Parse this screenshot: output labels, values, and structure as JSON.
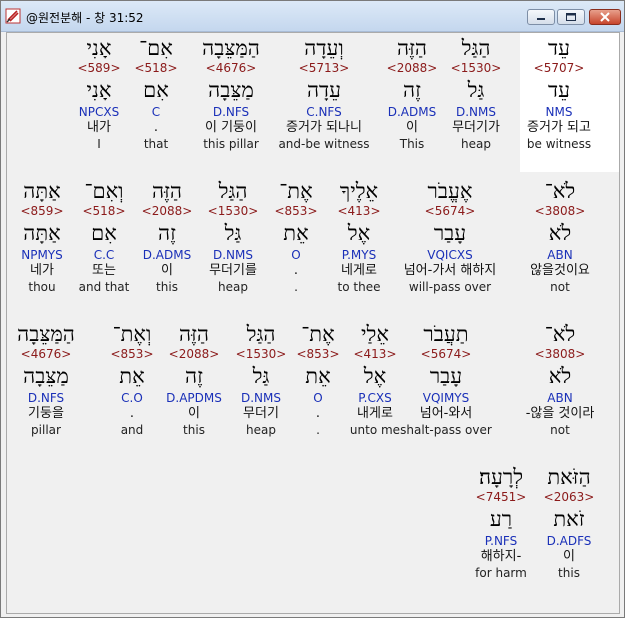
{
  "window": {
    "title": "@원전분해 - 창 31:52",
    "buttons": {
      "minimize": "minimize-icon",
      "maximize": "maximize-icon",
      "close": "close-icon"
    }
  },
  "colors": {
    "strong": "#8b1a1a",
    "morph": "#1a30b8",
    "highlight_bg": "#ffffff"
  },
  "rows": [
    {
      "words": [
        {
          "heb": "עֵד",
          "strong": "<5707>",
          "root": "עֵד",
          "morph": "NMS",
          "kor": "증거가 되고",
          "eng": "be witness"
        },
        {
          "heb": "הַגַּל",
          "strong": "<1530>",
          "root": "גַּל",
          "morph": "D.NMS",
          "kor": "무더기가",
          "eng": "heap"
        },
        {
          "heb": "הַזֶּה",
          "strong": "<2088>",
          "root": "זֶה",
          "morph": "D.ADMS",
          "kor": "이",
          "eng": "This"
        },
        {
          "heb": "וְעֵדָה",
          "strong": "<5713>",
          "root": "עֵדָה",
          "morph": "C.NFS",
          "kor": "증거가 되나니",
          "eng": "and-be witness"
        },
        {
          "heb": "הַמַּצֵּבָה",
          "strong": "<4676>",
          "root": "מַצֵּבָה",
          "morph": "D.NFS",
          "kor": "이 기둥이",
          "eng": "this pillar"
        },
        {
          "heb": "אִם־",
          "strong": "<518>",
          "root": "אִם",
          "morph": "C",
          "kor": ".",
          "eng": "that"
        },
        {
          "heb": "אָנִי",
          "strong": "<589>",
          "root": "אָנִי",
          "morph": "NPCXS",
          "kor": "내가",
          "eng": "I"
        }
      ]
    },
    {
      "words": [
        {
          "heb": "לֹא־",
          "strong": "<3808>",
          "root": "לֹא",
          "morph": "ABN",
          "kor": "않을것이요",
          "eng": "not"
        },
        {
          "heb": "אֶעֱבֹר",
          "strong": "<5674>",
          "root": "עָבַר",
          "morph": "VQICXS",
          "kor": "넘어-가서 해하지",
          "eng": "will-pass over"
        },
        {
          "heb": "אֵלֶיךָ",
          "strong": "<413>",
          "root": "אֶל",
          "morph": "P.MYS",
          "kor": "네게로",
          "eng": "to thee"
        },
        {
          "heb": "אֶת־",
          "strong": "<853>",
          "root": "אֵת",
          "morph": "O",
          "kor": ".",
          "eng": "."
        },
        {
          "heb": "הַגַּל",
          "strong": "<1530>",
          "root": "גַּל",
          "morph": "D.NMS",
          "kor": "무더기를",
          "eng": "heap"
        },
        {
          "heb": "הַזֶּה",
          "strong": "<2088>",
          "root": "זֶה",
          "morph": "D.ADMS",
          "kor": "이",
          "eng": "this"
        },
        {
          "heb": "וְאִם־",
          "strong": "<518>",
          "root": "אִם",
          "morph": "C.C",
          "kor": "또는",
          "eng": "and that"
        },
        {
          "heb": "אַתָּה",
          "strong": "<859>",
          "root": "אַתָּה",
          "morph": "NPMYS",
          "kor": "네가",
          "eng": "thou"
        }
      ]
    },
    {
      "words": [
        {
          "heb": "לֹא־",
          "strong": "<3808>",
          "root": "לֹא",
          "morph": "ABN",
          "kor": "-않을 것이라",
          "eng": "not"
        },
        {
          "heb": "תַעֲבֹר",
          "strong": "<5674>",
          "root": "עָבַר",
          "morph": "VQIMYS",
          "kor": "넘어-와서",
          "eng": "shalt-pass over"
        },
        {
          "heb": "אֵלַי",
          "strong": "<413>",
          "root": "אֶל",
          "morph": "P.CXS",
          "kor": "내게로",
          "eng": "unto me"
        },
        {
          "heb": "אֶת־",
          "strong": "<853>",
          "root": "אֵת",
          "morph": "O",
          "kor": ".",
          "eng": "."
        },
        {
          "heb": "הַגַּל",
          "strong": "<1530>",
          "root": "גַּל",
          "morph": "D.NMS",
          "kor": "무더기",
          "eng": "heap"
        },
        {
          "heb": "הַזֶּה",
          "strong": "<2088>",
          "root": "זֶה",
          "morph": "D.APDMS",
          "kor": "이",
          "eng": "this"
        },
        {
          "heb": "וְאֶת־",
          "strong": "<853>",
          "root": "אֵת",
          "morph": "C.O",
          "kor": ".",
          "eng": "and"
        },
        {
          "heb": "הַמַּצֵּבָה",
          "strong": "<4676>",
          "root": "מַצֵּבָה",
          "morph": "D.NFS",
          "kor": "기둥을",
          "eng": "pillar"
        }
      ]
    },
    {
      "words": [
        {
          "heb": "הַזֹּאת",
          "strong": "<2063>",
          "root": "זֹאת",
          "morph": "D.ADFS",
          "kor": "이",
          "eng": "this"
        },
        {
          "heb": "לְרָעָה׃",
          "strong": "<7451>",
          "root": "רַע",
          "morph": "P.NFS",
          "kor": "해하지-",
          "eng": "for harm"
        }
      ]
    }
  ]
}
